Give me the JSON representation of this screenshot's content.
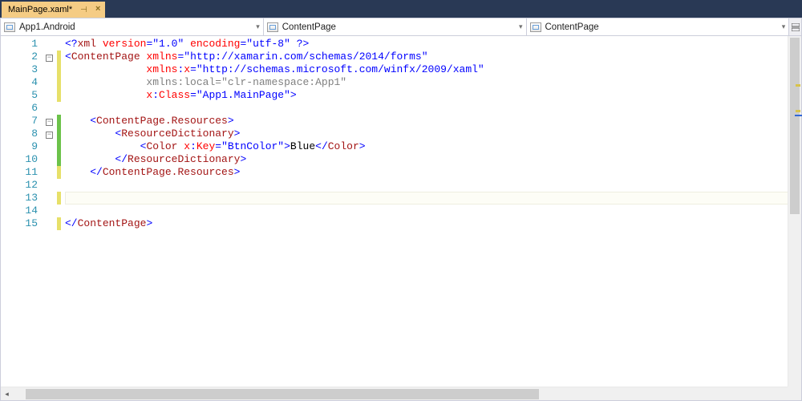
{
  "tab": {
    "title": "MainPage.xaml",
    "dirty_marker": "*",
    "close_glyph": "×"
  },
  "navbar": {
    "project": "App1.Android",
    "type": "ContentPage",
    "member": "ContentPage"
  },
  "editor": {
    "lines": [
      {
        "n": 1,
        "fold": "",
        "chg": "",
        "seg": [
          [
            "t-blue",
            "<?"
          ],
          [
            "t-brown",
            "xml "
          ],
          [
            "t-red",
            "version"
          ],
          [
            "t-blue",
            "="
          ],
          [
            "t-blue",
            "\"1.0\" "
          ],
          [
            "t-red",
            "encoding"
          ],
          [
            "t-blue",
            "="
          ],
          [
            "t-blue",
            "\"utf-8\" "
          ],
          [
            "t-blue",
            "?>"
          ]
        ]
      },
      {
        "n": 2,
        "fold": "-",
        "chg": "y",
        "seg": [
          [
            "t-blue",
            "<"
          ],
          [
            "t-brown",
            "ContentPage "
          ],
          [
            "t-red",
            "xmlns"
          ],
          [
            "t-blue",
            "="
          ],
          [
            "t-blue",
            "\"http://xamarin.com/schemas/2014/forms\""
          ]
        ]
      },
      {
        "n": 3,
        "fold": "",
        "chg": "y",
        "seg": [
          [
            "",
            "             "
          ],
          [
            "t-red",
            "xmlns"
          ],
          [
            "t-blue",
            ":"
          ],
          [
            "t-red",
            "x"
          ],
          [
            "t-blue",
            "="
          ],
          [
            "t-blue",
            "\"http://schemas.microsoft.com/winfx/2009/xaml\""
          ]
        ]
      },
      {
        "n": 4,
        "fold": "",
        "chg": "y",
        "seg": [
          [
            "",
            "             "
          ],
          [
            "t-gray",
            "xmlns"
          ],
          [
            "t-gray",
            ":"
          ],
          [
            "t-gray",
            "local"
          ],
          [
            "t-gray",
            "="
          ],
          [
            "t-gray",
            "\"clr-namespace:App1\""
          ]
        ]
      },
      {
        "n": 5,
        "fold": "",
        "chg": "y",
        "seg": [
          [
            "",
            "             "
          ],
          [
            "t-red",
            "x"
          ],
          [
            "t-blue",
            ":"
          ],
          [
            "t-red",
            "Class"
          ],
          [
            "t-blue",
            "="
          ],
          [
            "t-blue",
            "\"App1.MainPage\""
          ],
          [
            "t-blue",
            ">"
          ]
        ]
      },
      {
        "n": 6,
        "fold": "",
        "chg": "",
        "seg": [
          [
            "",
            ""
          ]
        ]
      },
      {
        "n": 7,
        "fold": "-",
        "chg": "g",
        "seg": [
          [
            "",
            "    "
          ],
          [
            "t-blue",
            "<"
          ],
          [
            "t-brown",
            "ContentPage.Resources"
          ],
          [
            "t-blue",
            ">"
          ]
        ]
      },
      {
        "n": 8,
        "fold": "-",
        "chg": "g",
        "seg": [
          [
            "",
            "        "
          ],
          [
            "t-blue",
            "<"
          ],
          [
            "t-brown",
            "ResourceDictionary"
          ],
          [
            "t-blue",
            ">"
          ]
        ]
      },
      {
        "n": 9,
        "fold": "",
        "chg": "g",
        "seg": [
          [
            "",
            "            "
          ],
          [
            "t-blue",
            "<"
          ],
          [
            "t-brown",
            "Color "
          ],
          [
            "t-red",
            "x"
          ],
          [
            "t-blue",
            ":"
          ],
          [
            "t-red",
            "Key"
          ],
          [
            "t-blue",
            "="
          ],
          [
            "t-blue",
            "\"BtnColor\""
          ],
          [
            "t-blue",
            ">"
          ],
          [
            "t-black",
            "Blue"
          ],
          [
            "t-blue",
            "</"
          ],
          [
            "t-brown",
            "Color"
          ],
          [
            "t-blue",
            ">"
          ]
        ]
      },
      {
        "n": 10,
        "fold": "",
        "chg": "g",
        "seg": [
          [
            "",
            "        "
          ],
          [
            "t-blue",
            "</"
          ],
          [
            "t-brown",
            "ResourceDictionary"
          ],
          [
            "t-blue",
            ">"
          ]
        ]
      },
      {
        "n": 11,
        "fold": "",
        "chg": "y",
        "seg": [
          [
            "",
            "    "
          ],
          [
            "t-blue",
            "</"
          ],
          [
            "t-brown",
            "ContentPage.Resources"
          ],
          [
            "t-blue",
            ">"
          ]
        ]
      },
      {
        "n": 12,
        "fold": "",
        "chg": "",
        "seg": [
          [
            "",
            ""
          ]
        ]
      },
      {
        "n": 13,
        "fold": "",
        "chg": "y",
        "cur": true,
        "seg": [
          [
            "",
            "    "
          ]
        ]
      },
      {
        "n": 14,
        "fold": "",
        "chg": "",
        "seg": [
          [
            "",
            ""
          ]
        ]
      },
      {
        "n": 15,
        "fold": "",
        "chg": "y",
        "seg": [
          [
            "t-blue",
            "</"
          ],
          [
            "t-brown",
            "ContentPage"
          ],
          [
            "t-blue",
            ">"
          ]
        ]
      }
    ]
  }
}
